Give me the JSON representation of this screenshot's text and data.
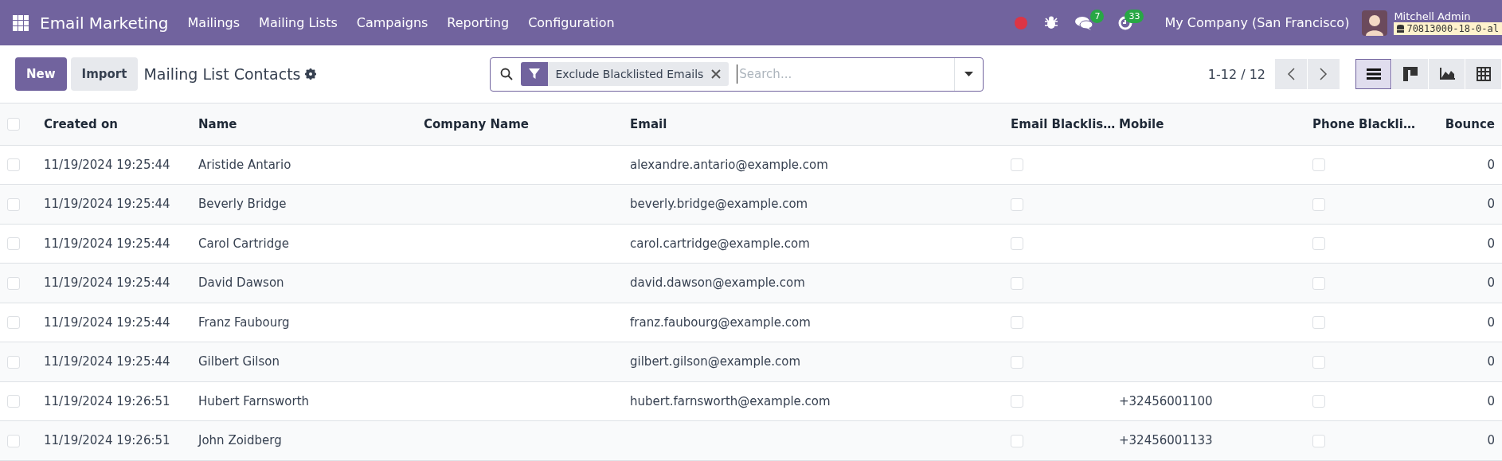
{
  "navbar": {
    "app_name": "Email Marketing",
    "menus": [
      "Mailings",
      "Mailing Lists",
      "Campaigns",
      "Reporting",
      "Configuration"
    ],
    "messages_count": "7",
    "activities_count": "33",
    "company": "My Company (San Francisco)",
    "user": "Mitchell Admin",
    "database": "70813000-18-0-al"
  },
  "control_panel": {
    "buttons": [
      "New",
      "Import"
    ],
    "title": "Mailing List Contacts",
    "filters": [
      "Exclude Blacklisted Emails"
    ],
    "search_placeholder": "Search...",
    "pager": "1-12 / 12",
    "views": [
      {
        "kind": "list",
        "selected": true
      },
      {
        "kind": "kanban",
        "selected": false
      },
      {
        "kind": "graph",
        "selected": false
      },
      {
        "kind": "pivot",
        "selected": false
      }
    ]
  },
  "table": {
    "all_selected": false,
    "columns": [
      "Created on",
      "Name",
      "Company Name",
      "Email",
      "Email Blacklis…",
      "Mobile",
      "Phone Blackli…",
      "Bounce"
    ],
    "rows": [
      {
        "selected": false,
        "created_on": "11/19/2024 19:25:44",
        "name": "Aristide Antario",
        "email": "alexandre.antario@example.com",
        "email_blacklisted": false,
        "phone_blacklisted": false,
        "bounce": "0"
      },
      {
        "selected": false,
        "created_on": "11/19/2024 19:25:44",
        "name": "Beverly Bridge",
        "email": "beverly.bridge@example.com",
        "email_blacklisted": false,
        "phone_blacklisted": false,
        "bounce": "0"
      },
      {
        "selected": false,
        "created_on": "11/19/2024 19:25:44",
        "name": "Carol Cartridge",
        "email": "carol.cartridge@example.com",
        "email_blacklisted": false,
        "phone_blacklisted": false,
        "bounce": "0"
      },
      {
        "selected": false,
        "created_on": "11/19/2024 19:25:44",
        "name": "David Dawson",
        "email": "david.dawson@example.com",
        "email_blacklisted": false,
        "phone_blacklisted": false,
        "bounce": "0"
      },
      {
        "selected": false,
        "created_on": "11/19/2024 19:25:44",
        "name": "Franz Faubourg",
        "email": "franz.faubourg@example.com",
        "email_blacklisted": false,
        "phone_blacklisted": false,
        "bounce": "0"
      },
      {
        "selected": false,
        "created_on": "11/19/2024 19:25:44",
        "name": "Gilbert Gilson",
        "email": "gilbert.gilson@example.com",
        "email_blacklisted": false,
        "phone_blacklisted": false,
        "bounce": "0"
      },
      {
        "selected": false,
        "created_on": "11/19/2024 19:26:51",
        "name": "Hubert Farnsworth",
        "email": "hubert.farnsworth@example.com",
        "email_blacklisted": false,
        "mobile": "+32456001100",
        "phone_blacklisted": false,
        "bounce": "0"
      },
      {
        "selected": false,
        "created_on": "11/19/2024 19:26:51",
        "name": "John Zoidberg",
        "email_blacklisted": false,
        "mobile": "+32456001133",
        "phone_blacklisted": false,
        "bounce": "0"
      }
    ]
  }
}
